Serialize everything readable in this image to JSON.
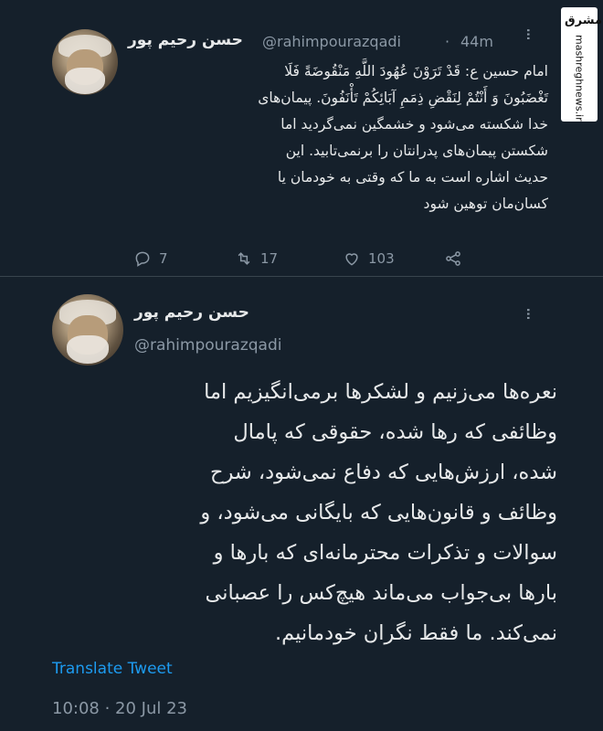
{
  "tweet1": {
    "name": "حسن رحیم پور",
    "handle": "@rahimpourazqadi",
    "time_sep": "·",
    "time": "44m",
    "lines": [
      "امام حسین ع: قَدْ تَرَوْنَ عُهُودَ اللَّهِ مَنْقُوضَةً فَلَا",
      "تَغْضَبُونَ وَ أَنْتُمْ لِنَقْضِ ذِمَمِ آبَائِكُمْ تَأْنَفُونَ. پیمان‌های",
      "خدا شکسته می‌شود و خشمگین نمی‌گردید اما",
      "شکستن پیمان‌های پدرانتان را برنمی‌تابید. این",
      "حدیث اشاره است به ما که وقتی به خودمان یا",
      "کسان‌مان توهین شود"
    ],
    "actions": {
      "reply_icon": "reply-icon",
      "replies": "7",
      "retweet_icon": "retweet-icon",
      "retweets": "17",
      "like_icon": "heart-icon",
      "likes": "103",
      "share_icon": "share-icon"
    }
  },
  "tweet2": {
    "name": "حسن رحیم پور",
    "handle": "@rahimpourazqadi",
    "lines": [
      "نعره‌ها می‌زنیم و لشکرها برمی‌انگیزیم اما",
      "وظائفی که رها شده، حقوقی که پامال",
      "شده، ارزش‌هایی که دفاع نمی‌شود، شرح",
      "وظائف و قانون‌هایی که بایگانی می‌شود، و",
      "سوالات و تذکرات محترمانه‌ای که بارها و",
      "بارها بی‌جواب می‌ماند هیچ‌کس را عصبانی",
      "نمی‌کند. ما فقط نگران خودمانیم."
    ],
    "translate_label": "Translate Tweet",
    "timestamp": "10:08 · 20 Jul 23"
  },
  "watermark": {
    "logo_text": "مشرق",
    "site": "mashreghnews.ir"
  },
  "colors": {
    "background": "#15202b",
    "text": "#e7e9ea",
    "secondary": "#8b98a5",
    "link": "#1d9bf0"
  }
}
